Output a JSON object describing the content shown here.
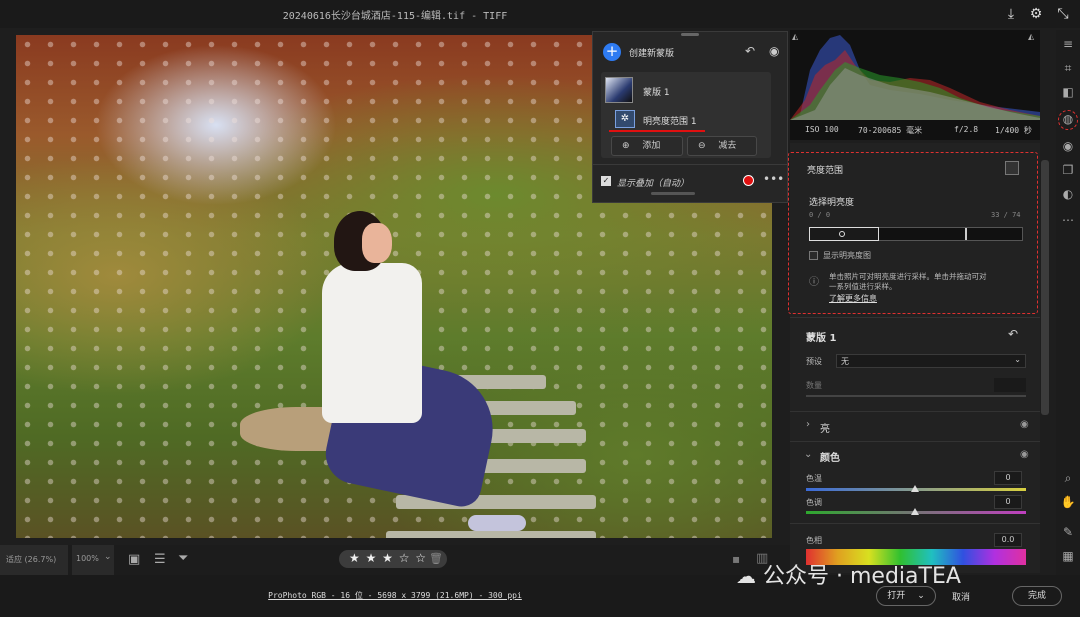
{
  "window": {
    "title": "20240616长沙台城酒店-115-编辑.tif  -   TIFF"
  },
  "mask_panel": {
    "create_label": "创建新蒙版",
    "mask_name": "蒙版 1",
    "component_name": "明亮度范围 1",
    "add_label": "添加",
    "subtract_label": "减去",
    "overlay_label": "显示叠加（自动）",
    "overlay_color": "#e01010"
  },
  "exif": {
    "iso": "ISO 100",
    "lens": "70-200685 毫米",
    "aperture": "f/2.8",
    "shutter": "1/400 秒"
  },
  "luminance_range": {
    "title": "亮度范围",
    "select_label": "选择明亮度",
    "range_left": "0 / 0",
    "range_right": "33 / 74",
    "show_map_label": "显示明亮度图",
    "info_text_1": "单击照片可对明亮度进行采样。单击并拖动可对",
    "info_text_2": "一系列值进行采样。",
    "learn_more": "了解更多信息"
  },
  "mask_settings": {
    "title": "蒙版 1",
    "preset_label": "预设",
    "preset_value": "无",
    "amount_label": "数量"
  },
  "light_section": {
    "title": "亮"
  },
  "color_section": {
    "title": "颜色",
    "temp_label": "色温",
    "temp_value": "0",
    "tint_label": "色调",
    "tint_value": "0",
    "hue_label": "色相",
    "hue_value": "0.0"
  },
  "bottom_bar": {
    "zoom_fit": "适应 (26.7%)",
    "zoom_100": "100%",
    "stars": "★ ★ ★ ☆ ☆"
  },
  "status": {
    "info": "ProPhoto RGB - 16 位 - 5698 x 3799 (21.6MP) - 300 ppi",
    "open_label": "打开",
    "cancel_label": "取消",
    "done_label": "完成",
    "watermark": "公众号 · mediaTEA"
  }
}
